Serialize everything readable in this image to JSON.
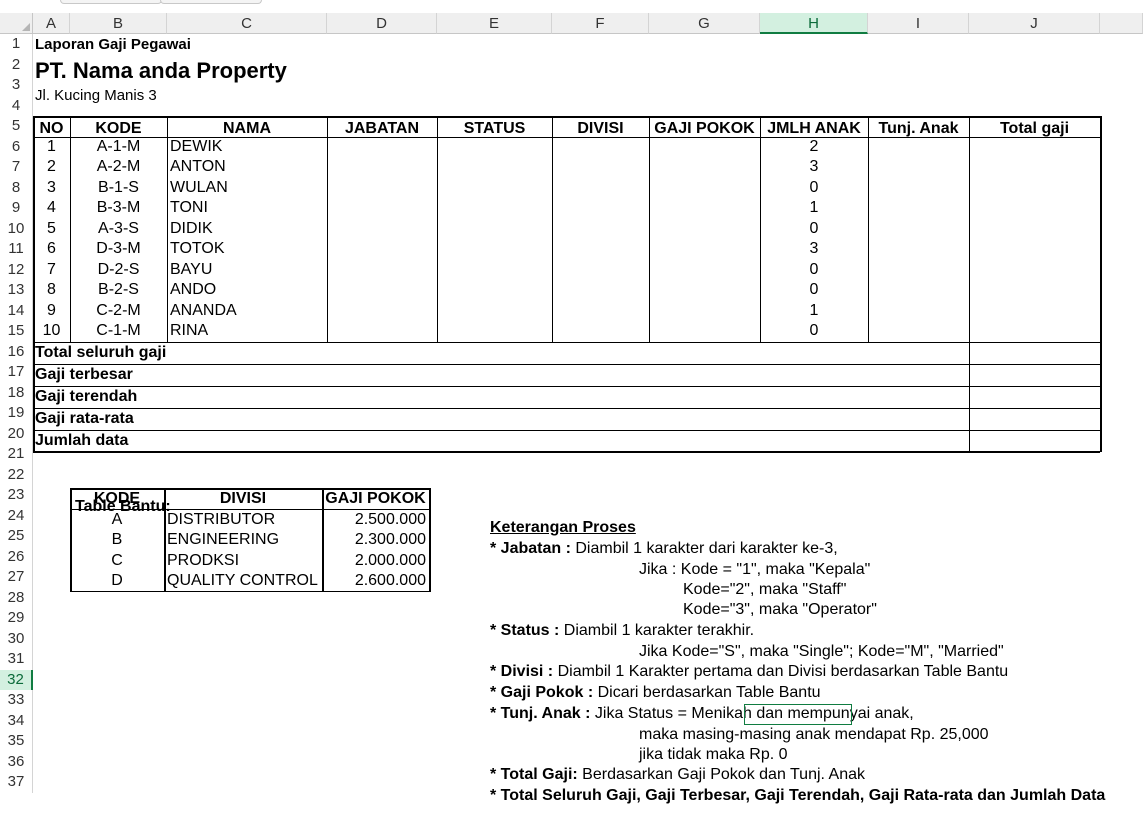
{
  "column_headers": [
    "A",
    "B",
    "C",
    "D",
    "E",
    "F",
    "G",
    "H",
    "I",
    "J"
  ],
  "row_numbers": [
    "1",
    "2",
    "3",
    "4",
    "5",
    "6",
    "7",
    "8",
    "9",
    "10",
    "11",
    "12",
    "13",
    "14",
    "15",
    "16",
    "17",
    "18",
    "19",
    "20",
    "21",
    "22",
    "23",
    "24",
    "25",
    "26",
    "27",
    "28",
    "29",
    "30",
    "31",
    "32",
    "33",
    "34",
    "35",
    "36",
    "37"
  ],
  "selected_column": "H",
  "selected_row": "32",
  "header": {
    "line1": "Laporan Gaji Pegawai",
    "company": "PT. Nama anda Property",
    "address": "Jl. Kucing Manis 3"
  },
  "main_table": {
    "columns": [
      "NO",
      "KODE",
      "NAMA",
      "JABATAN",
      "STATUS",
      "DIVISI",
      "GAJI POKOK",
      "JMLH ANAK",
      "Tunj. Anak",
      "Total gaji"
    ],
    "rows": [
      {
        "no": "1",
        "kode": "A-1-M",
        "nama": "DEWIK",
        "anak": "2"
      },
      {
        "no": "2",
        "kode": "A-2-M",
        "nama": "ANTON",
        "anak": "3"
      },
      {
        "no": "3",
        "kode": "B-1-S",
        "nama": "WULAN",
        "anak": "0"
      },
      {
        "no": "4",
        "kode": "B-3-M",
        "nama": "TONI",
        "anak": "1"
      },
      {
        "no": "5",
        "kode": "A-3-S",
        "nama": "DIDIK",
        "anak": "0"
      },
      {
        "no": "6",
        "kode": "D-3-M",
        "nama": "TOTOK",
        "anak": "3"
      },
      {
        "no": "7",
        "kode": "D-2-S",
        "nama": "BAYU",
        "anak": "0"
      },
      {
        "no": "8",
        "kode": "B-2-S",
        "nama": "ANDO",
        "anak": "0"
      },
      {
        "no": "9",
        "kode": "C-2-M",
        "nama": "ANANDA",
        "anak": "1"
      },
      {
        "no": "10",
        "kode": "C-1-M",
        "nama": "RINA",
        "anak": "0"
      }
    ],
    "summary_labels": [
      "Total seluruh gaji",
      "Gaji terbesar",
      "Gaji terendah",
      "Gaji rata-rata",
      "Jumlah data"
    ]
  },
  "table_bantu": {
    "title": "Table Bantu:",
    "columns": [
      "KODE",
      "DIVISI",
      "GAJI POKOK"
    ],
    "rows": [
      {
        "kode": "A",
        "divisi": "DISTRIBUTOR",
        "gaji": "2.500.000"
      },
      {
        "kode": "B",
        "divisi": "ENGINEERING",
        "gaji": "2.300.000"
      },
      {
        "kode": "C",
        "divisi": "PRODKSI",
        "gaji": "2.000.000"
      },
      {
        "kode": "D",
        "divisi": "QUALITY CONTROL",
        "gaji": "2.600.000"
      }
    ]
  },
  "keterangan": {
    "title": "Keterangan Proses",
    "jabatan_label": "* Jabatan :",
    "jabatan_text": " Diambil 1 karakter dari karakter ke-3,",
    "jabatan_rule1": "Jika : Kode = \"1\", maka \"Kepala\"",
    "jabatan_rule2": "Kode=\"2\", maka \"Staff\"",
    "jabatan_rule3": "Kode=\"3\", maka \"Operator\"",
    "status_label": "* Status :",
    "status_text": " Diambil 1 karakter terakhir.",
    "status_rule": "Jika Kode=\"S\", maka \"Single\"; Kode=\"M\", \"Married\"",
    "divisi_label": "* Divisi :",
    "divisi_text": " Diambil 1 Karakter pertama dan Divisi berdasarkan Table Bantu",
    "gaji_label": "* Gaji Pokok :",
    "gaji_text": " Dicari berdasarkan Table Bantu",
    "tunj_label": "* Tunj. Anak :",
    "tunj_text": " Jika Status = Menikah dan mempunyai anak,",
    "tunj_rule1": "maka masing-masing anak mendapat Rp. 25,000",
    "tunj_rule2": "jika tidak maka Rp. 0",
    "total_label": "* Total Gaji:",
    "total_text": " Berdasarkan Gaji Pokok dan Tunj. Anak",
    "summary_line": "* Total Seluruh Gaji, Gaji Terbesar, Gaji Terendah, Gaji Rata-rata dan Jumlah Data"
  }
}
